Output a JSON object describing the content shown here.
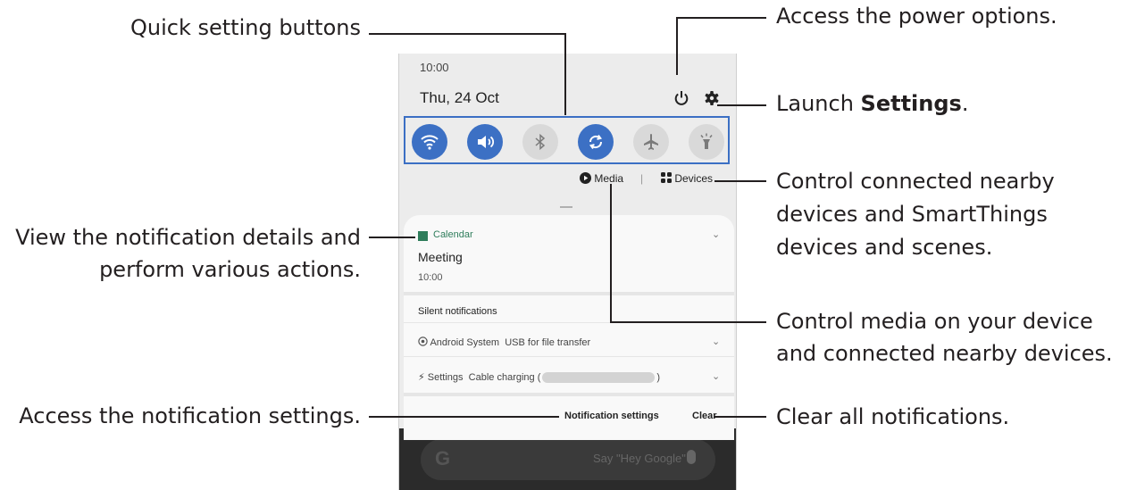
{
  "callouts": {
    "quick_settings": "Quick setting buttons",
    "power": "Access the power options.",
    "launch_prefix": "Launch ",
    "launch_bold": "Settings",
    "launch_suffix": ".",
    "devices_1": "Control connected nearby",
    "devices_2": "devices and SmartThings",
    "devices_3": "devices and scenes.",
    "details_1": "View the notification details and",
    "details_2": "perform various actions.",
    "media_1": "Control media on your device",
    "media_2": "and connected nearby devices.",
    "notif_settings": "Access the notification settings.",
    "clear_all": "Clear all notifications."
  },
  "phone": {
    "time": "10:00",
    "date": "Thu, 24 Oct",
    "quick_buttons": [
      {
        "icon": "wifi-icon",
        "state": "on"
      },
      {
        "icon": "sound-icon",
        "state": "on"
      },
      {
        "icon": "bluetooth-icon",
        "state": "off"
      },
      {
        "icon": "auto-rotate-icon",
        "state": "on"
      },
      {
        "icon": "airplane-icon",
        "state": "off"
      },
      {
        "icon": "flashlight-icon",
        "state": "off"
      }
    ],
    "media_label": "Media",
    "devices_label": "Devices",
    "separator": "|",
    "calendar_app": "Calendar",
    "meeting_title": "Meeting",
    "meeting_time": "10:00",
    "silent_header": "Silent notifications",
    "android_app": "Android System",
    "android_text": "USB for file transfer",
    "settings_app": "Settings",
    "settings_text_start": "Cable charging (",
    "settings_text_end": ")",
    "notification_settings": "Notification settings",
    "clear": "Clear",
    "google_letter": "G",
    "google_hint": "Say \"Hey Google\""
  },
  "colors": {
    "accent": "#3c70c4",
    "calendar_green": "#2e7d5b",
    "text": "#231f20"
  }
}
